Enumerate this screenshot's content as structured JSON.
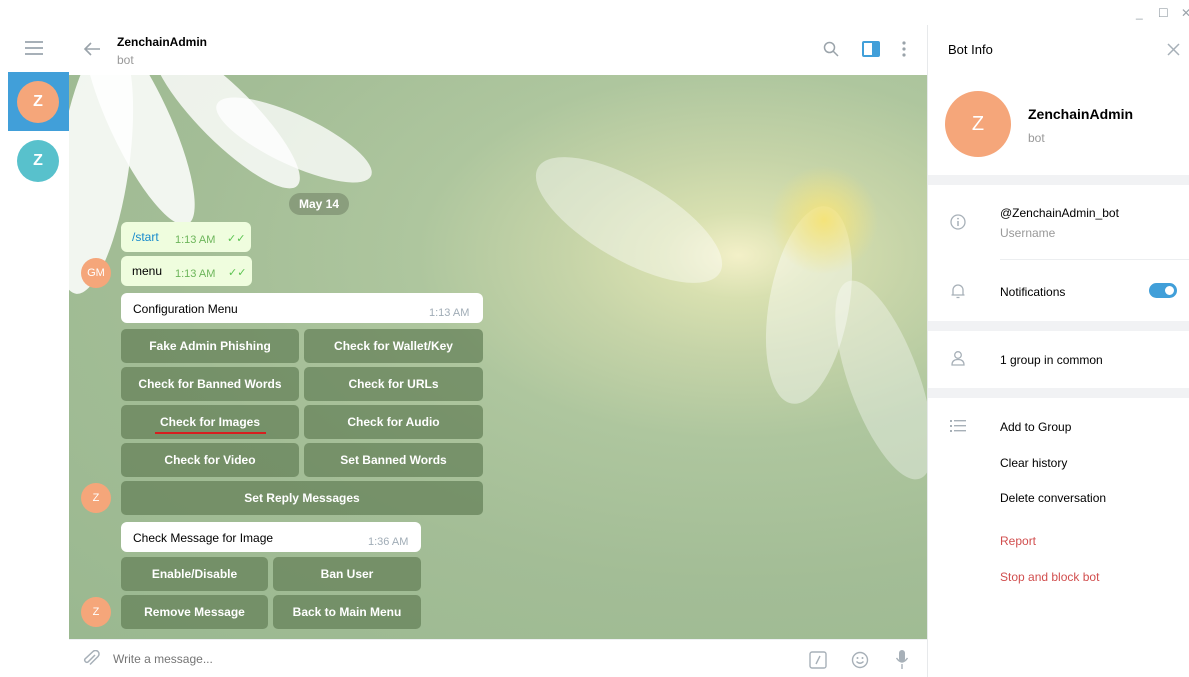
{
  "window": {
    "minimize": "_",
    "maximize": "☐",
    "close": "✕"
  },
  "sidebar": {
    "dialogs": [
      {
        "initial": "Z",
        "color": "#f5a67a",
        "active": true
      },
      {
        "initial": "Z",
        "color": "#58c1cc",
        "active": false
      }
    ]
  },
  "header": {
    "title": "ZenchainAdmin",
    "subtitle": "bot",
    "accent": "#419fd9"
  },
  "chat": {
    "date_pill": "May 14",
    "messages": [
      {
        "text": "/start",
        "time": "1:13 AM",
        "checks": "✓✓"
      },
      {
        "text": "menu",
        "time": "1:13 AM",
        "checks": "✓✓"
      }
    ],
    "sender_avatar": "GM",
    "bot_avatar": "Z",
    "config_menu": {
      "text": "Configuration Menu",
      "time": "1:13 AM",
      "buttons": [
        [
          "Fake Admin Phishing",
          "Check for Wallet/Key"
        ],
        [
          "Check for Banned Words",
          "Check for URLs"
        ],
        [
          "Check for Images",
          "Check for Audio"
        ],
        [
          "Check for Video",
          "Set Banned Words"
        ],
        [
          "Set Reply Messages"
        ]
      ]
    },
    "image_menu": {
      "text": "Check Message for Image",
      "time": "1:36 AM",
      "buttons": [
        [
          "Enable/Disable",
          "Ban User"
        ],
        [
          "Remove Message",
          "Back to Main Menu"
        ]
      ]
    }
  },
  "composer": {
    "placeholder": "Write a message..."
  },
  "bot_info": {
    "title": "Bot Info",
    "name": "ZenchainAdmin",
    "status": "bot",
    "avatar_initial": "Z",
    "username": "@ZenchainAdmin_bot",
    "username_label": "Username",
    "notifications_label": "Notifications",
    "notifications_on": true,
    "groups_common": "1 group in common",
    "actions": [
      "Add to Group",
      "Clear history",
      "Delete conversation"
    ],
    "danger_actions": [
      "Report",
      "Stop and block bot"
    ],
    "danger_color": "#d14e4e"
  }
}
